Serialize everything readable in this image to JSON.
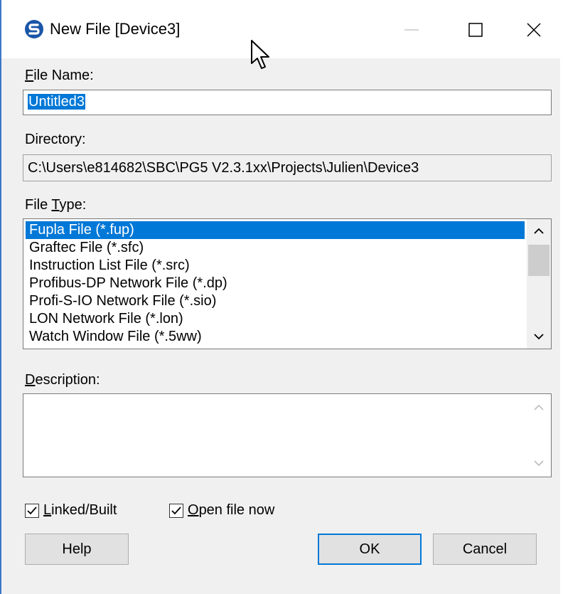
{
  "window": {
    "title": "New File [Device3]",
    "app_icon": "sbc-pg5-logo-icon",
    "controls": [
      "minimize-icon",
      "maximize-icon",
      "close-icon"
    ]
  },
  "filename": {
    "label": "File Name:",
    "label_first": "F",
    "label_rest": "ile Name:",
    "value": "Untitled3"
  },
  "directory": {
    "label": "Directory:",
    "value": "C:\\Users\\e814682\\SBC\\PG5 V2.3.1xx\\Projects\\Julien\\Device3"
  },
  "filetype": {
    "label_pre": "File ",
    "label_ul": "T",
    "label_post": "ype:",
    "items": [
      "Fupla File (*.fup)",
      "Graftec File (*.sfc)",
      "Instruction List File (*.src)",
      "Profibus-DP Network File (*.dp)",
      "Profi-S-IO Network File (*.sio)",
      "LON Network File (*.lon)",
      "Watch Window File (*.5ww)"
    ],
    "selected": "Fupla File (*.fup)"
  },
  "description": {
    "label_ul": "D",
    "label_rest": "escription:",
    "value": ""
  },
  "options": {
    "linked_ul": "L",
    "linked_rest": "inked/Built",
    "linked_checked": true,
    "open_ul": "O",
    "open_rest": "pen file now",
    "open_checked": true
  },
  "buttons": {
    "help": "Help",
    "ok": "OK",
    "cancel": "Cancel"
  },
  "colors": {
    "selection": "#0078d7",
    "accent_border": "#3c78c8"
  }
}
